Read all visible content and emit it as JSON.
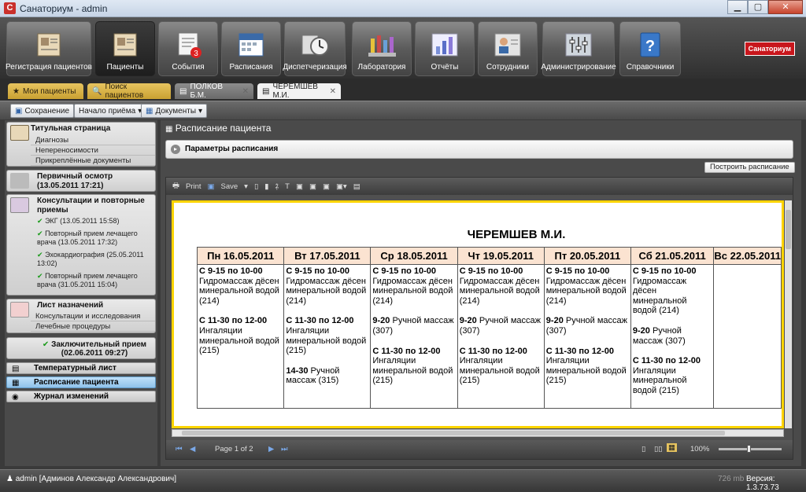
{
  "window": {
    "title": "Санаториум - admin",
    "icon_letter": "С"
  },
  "ribbon": {
    "buttons": [
      {
        "label": "Регистрация пациентов",
        "icon": "registration-icon"
      },
      {
        "label": "Пациенты",
        "icon": "patients-icon",
        "active": true
      },
      {
        "label": "События",
        "icon": "events-icon",
        "badge": "3"
      },
      {
        "label": "Расписания",
        "icon": "calendar-icon"
      },
      {
        "label": "Диспетчеризация",
        "icon": "clock-icon"
      },
      {
        "label": "Лаборатория",
        "icon": "lab-icon"
      },
      {
        "label": "Отчёты",
        "icon": "chart-icon"
      },
      {
        "label": "Сотрудники",
        "icon": "staff-icon"
      },
      {
        "label": "Администрирование",
        "icon": "admin-icon"
      },
      {
        "label": "Справочники",
        "icon": "help-book-icon"
      }
    ],
    "brand": "Санаториум"
  },
  "tabs": [
    {
      "label": "Мои пациенты",
      "style": "gold"
    },
    {
      "label": "Поиск пациентов",
      "style": "gold"
    },
    {
      "label": "ПОЛКОВ Б.М.",
      "style": "gray"
    },
    {
      "label": "ЧЕРЕМШЕВ М.И.",
      "style": "white"
    }
  ],
  "toolbar": {
    "save": "Сохранение",
    "start": "Начало приёма",
    "docs": "Документы"
  },
  "left": {
    "g1": {
      "title": "Титульная страница",
      "items": [
        "Диагнозы",
        "Непереносимости",
        "Прикреплённые документы"
      ]
    },
    "g2": {
      "title": "Первичный осмотр (13.05.2011 17:21)"
    },
    "g3": {
      "title": "Консультации и повторные приемы",
      "items": [
        "ЭКГ (13.05.2011 15:58)",
        "Повторный прием лечащего врача (13.05.2011 17:32)",
        "Эхокардиография (25.05.2011 13:02)",
        "Повторный прием лечащего врача (31.05.2011 15:04)"
      ]
    },
    "g4": {
      "title": "Лист назначений",
      "items": [
        "Консультации и исследования",
        "Лечебные процедуры"
      ]
    },
    "g5": {
      "title": "Заключительный прием (02.06.2011 09:27)"
    },
    "flat": [
      "Температурный лист",
      "Расписание пациента",
      "Журнал изменений"
    ]
  },
  "main": {
    "title": "Расписание пациента",
    "params": "Параметры расписания",
    "build": "Построить расписание",
    "rtool": {
      "print": "Print",
      "save": "Save"
    },
    "page_info": "Page 1 of 2",
    "zoom": "100%"
  },
  "report": {
    "name": "ЧЕРЕМШЕВ М.И.",
    "days": [
      {
        "head": "Пн 16.05.2011",
        "entries": [
          {
            "t": "С 9-15 по 10-00",
            "d": "Гидромассаж дёсен минеральной водой (214)"
          },
          {
            "t": "С 11-30 по 12-00",
            "d": "Ингаляции минеральной водой (215)"
          }
        ]
      },
      {
        "head": "Вт 17.05.2011",
        "entries": [
          {
            "t": "С 9-15 по 10-00",
            "d": "Гидромассаж дёсен минеральной водой (214)"
          },
          {
            "t": "С 11-30 по 12-00",
            "d": "Ингаляции минеральной водой (215)"
          },
          {
            "t": "14-30",
            "d": "Ручной массаж (315)",
            "inline": true
          }
        ]
      },
      {
        "head": "Ср 18.05.2011",
        "entries": [
          {
            "t": "С 9-15 по 10-00",
            "d": "Гидромассаж дёсен минеральной водой (214)"
          },
          {
            "t": "9-20",
            "d": "Ручной массаж (307)",
            "inline": true
          },
          {
            "t": "С 11-30 по 12-00",
            "d": "Ингаляции минеральной водой (215)"
          }
        ]
      },
      {
        "head": "Чт 19.05.2011",
        "entries": [
          {
            "t": "С 9-15 по 10-00",
            "d": "Гидромассаж дёсен минеральной водой (214)"
          },
          {
            "t": "9-20",
            "d": "Ручной массаж (307)",
            "inline": true
          },
          {
            "t": "С 11-30 по 12-00",
            "d": "Ингаляции минеральной водой (215)"
          }
        ]
      },
      {
        "head": "Пт 20.05.2011",
        "entries": [
          {
            "t": "С 9-15 по 10-00",
            "d": "Гидромассаж дёсен минеральной водой (214)"
          },
          {
            "t": "9-20",
            "d": "Ручной массаж (307)",
            "inline": true
          },
          {
            "t": "С 11-30 по 12-00",
            "d": "Ингаляции минеральной водой (215)"
          }
        ]
      },
      {
        "head": "Сб 21.05.2011",
        "entries": [
          {
            "t": "С 9-15 по 10-00",
            "d": "Гидромассаж дёсен минеральной водой (214)"
          },
          {
            "t": "9-20",
            "d": "Ручной массаж (307)",
            "inline": true
          },
          {
            "t": "С 11-30 по 12-00",
            "d": "Ингаляции минеральной водой (215)"
          }
        ]
      },
      {
        "head": "Вс 22.05.2011",
        "entries": []
      }
    ]
  },
  "status": {
    "user": "admin [Админов Александр Александрович]",
    "mem": "726 mb",
    "version": "Версия: 1.3.73.73"
  }
}
